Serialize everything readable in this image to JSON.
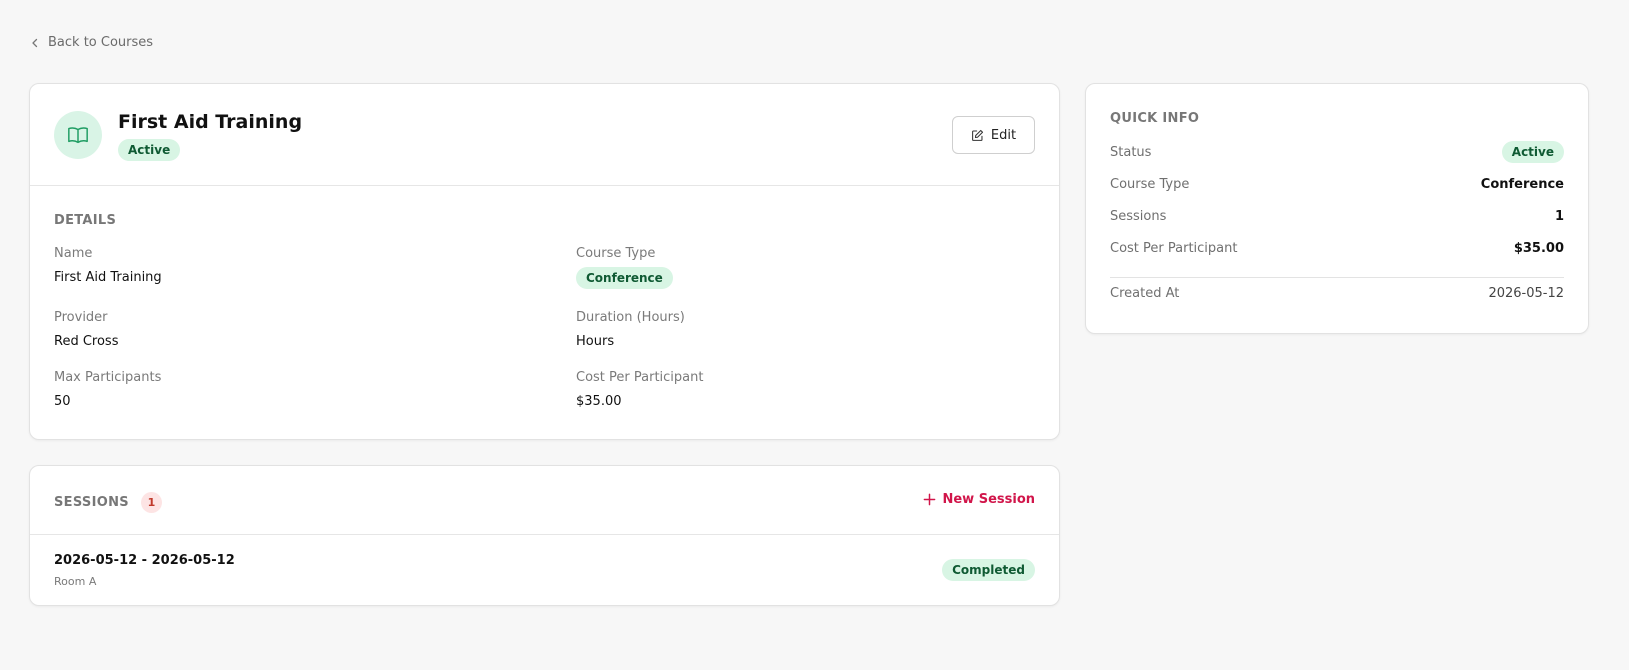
{
  "nav": {
    "back_label": "Back to Courses"
  },
  "course": {
    "title": "First Aid Training",
    "status": "Active",
    "edit_label": "Edit"
  },
  "details": {
    "section_title": "DETAILS",
    "name_label": "Name",
    "name_value": "First Aid Training",
    "course_type_label": "Course Type",
    "course_type_value": "Conference",
    "provider_label": "Provider",
    "provider_value": "Red Cross",
    "duration_label": "Duration (Hours)",
    "duration_value": "Hours",
    "max_participants_label": "Max Participants",
    "max_participants_value": "50",
    "cost_label": "Cost Per Participant",
    "cost_value": "$35.00"
  },
  "sessions": {
    "section_title": "SESSIONS",
    "count": "1",
    "new_label": "New Session",
    "items": [
      {
        "dates": "2026-05-12 - 2026-05-12",
        "room": "Room A",
        "status": "Completed"
      }
    ]
  },
  "quick_info": {
    "title": "QUICK INFO",
    "status_label": "Status",
    "status_value": "Active",
    "course_type_label": "Course Type",
    "course_type_value": "Conference",
    "sessions_label": "Sessions",
    "sessions_value": "1",
    "cost_label": "Cost Per Participant",
    "cost_value": "$35.00",
    "created_label": "Created At",
    "created_value": "2026-05-12"
  },
  "icons": {
    "back": "chevron-left-icon",
    "course": "book-open-icon",
    "edit": "edit-icon",
    "add": "plus-icon"
  },
  "colors": {
    "accent": "#d1154a",
    "success_bg": "#d8f5e4",
    "success_text": "#0f5a33",
    "icon_green": "#1f9d63"
  }
}
